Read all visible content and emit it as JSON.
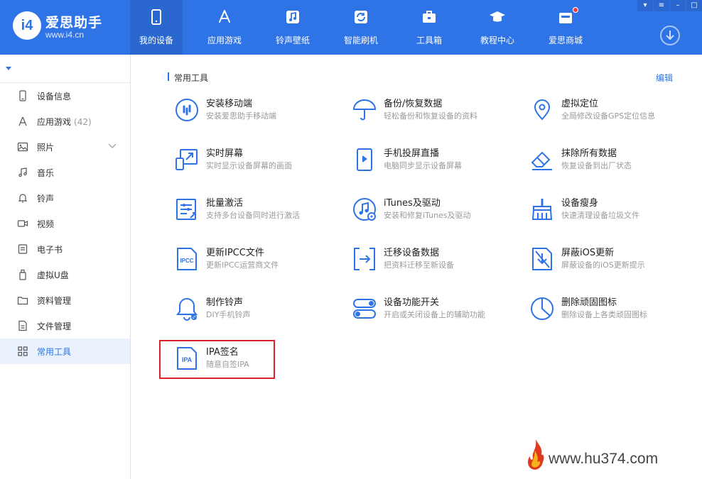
{
  "app": {
    "name": "爱思助手",
    "url": "www.i4.cn",
    "logo_mark": "i4"
  },
  "nav": [
    {
      "label": "我的设备",
      "icon": "phone-icon",
      "active": true
    },
    {
      "label": "应用游戏",
      "icon": "app-store-icon"
    },
    {
      "label": "铃声壁纸",
      "icon": "music-icon"
    },
    {
      "label": "智能刷机",
      "icon": "refresh-icon"
    },
    {
      "label": "工具箱",
      "icon": "toolbox-icon"
    },
    {
      "label": "教程中心",
      "icon": "graduation-cap-icon"
    },
    {
      "label": "爱思商城",
      "icon": "shop-icon",
      "badge": true
    }
  ],
  "window_controls": [
    "▾",
    "≡",
    "–",
    "□"
  ],
  "sidebar": {
    "items": [
      {
        "label": "设备信息",
        "icon": "device-info-icon"
      },
      {
        "label": "应用游戏",
        "count": "(42)",
        "icon": "app-icon"
      },
      {
        "label": "照片",
        "icon": "photo-icon",
        "expandable": true
      },
      {
        "label": "音乐",
        "icon": "music-note-icon"
      },
      {
        "label": "铃声",
        "icon": "bell-icon"
      },
      {
        "label": "视频",
        "icon": "video-icon"
      },
      {
        "label": "电子书",
        "icon": "book-icon"
      },
      {
        "label": "虚拟U盘",
        "icon": "usb-icon"
      },
      {
        "label": "资料管理",
        "icon": "folder-icon"
      },
      {
        "label": "文件管理",
        "icon": "file-icon"
      },
      {
        "label": "常用工具",
        "icon": "grid-icon",
        "active": true
      }
    ]
  },
  "main": {
    "section_title": "常用工具",
    "edit_label": "编辑",
    "tools": [
      {
        "title": "安装移动端",
        "sub": "安装爱思助手移动端",
        "icon": "install-mobile-icon"
      },
      {
        "title": "备份/恢复数据",
        "sub": "轻松备份和恢复设备的资料",
        "icon": "umbrella-icon"
      },
      {
        "title": "虚拟定位",
        "sub": "全局修改设备GPS定位信息",
        "icon": "location-pin-icon"
      },
      {
        "title": "实时屏幕",
        "sub": "实时显示设备屏幕的画面",
        "icon": "screen-mirror-icon"
      },
      {
        "title": "手机投屏直播",
        "sub": "电脑同步显示设备屏幕",
        "icon": "play-phone-icon"
      },
      {
        "title": "抹除所有数据",
        "sub": "恢复设备到出厂状态",
        "icon": "eraser-icon"
      },
      {
        "title": "批量激活",
        "sub": "支持多台设备同时进行激活",
        "icon": "batch-activate-icon"
      },
      {
        "title": "iTunes及驱动",
        "sub": "安装和修复iTunes及驱动",
        "icon": "itunes-icon"
      },
      {
        "title": "设备瘦身",
        "sub": "快速清理设备垃圾文件",
        "icon": "broom-icon"
      },
      {
        "title": "更新IPCC文件",
        "sub": "更新IPCC运营商文件",
        "icon": "ipcc-file-icon"
      },
      {
        "title": "迁移设备数据",
        "sub": "把资料迁移至新设备",
        "icon": "migrate-icon"
      },
      {
        "title": "屏蔽iOS更新",
        "sub": "屏蔽设备的iOS更新提示",
        "icon": "block-update-icon"
      },
      {
        "title": "制作铃声",
        "sub": "DIY手机铃声",
        "icon": "ringtone-icon"
      },
      {
        "title": "设备功能开关",
        "sub": "开启或关闭设备上的辅助功能",
        "icon": "toggle-icon"
      },
      {
        "title": "删除顽固图标",
        "sub": "删除设备上各类顽固图标",
        "icon": "pie-icon"
      },
      {
        "title": "IPA签名",
        "sub": "随意自签IPA",
        "icon": "ipa-file-icon",
        "highlighted": true
      }
    ]
  },
  "watermark": {
    "text": "www.hu374.com"
  },
  "colors": {
    "brand": "#2f74e6",
    "highlight": "#d9232d"
  }
}
